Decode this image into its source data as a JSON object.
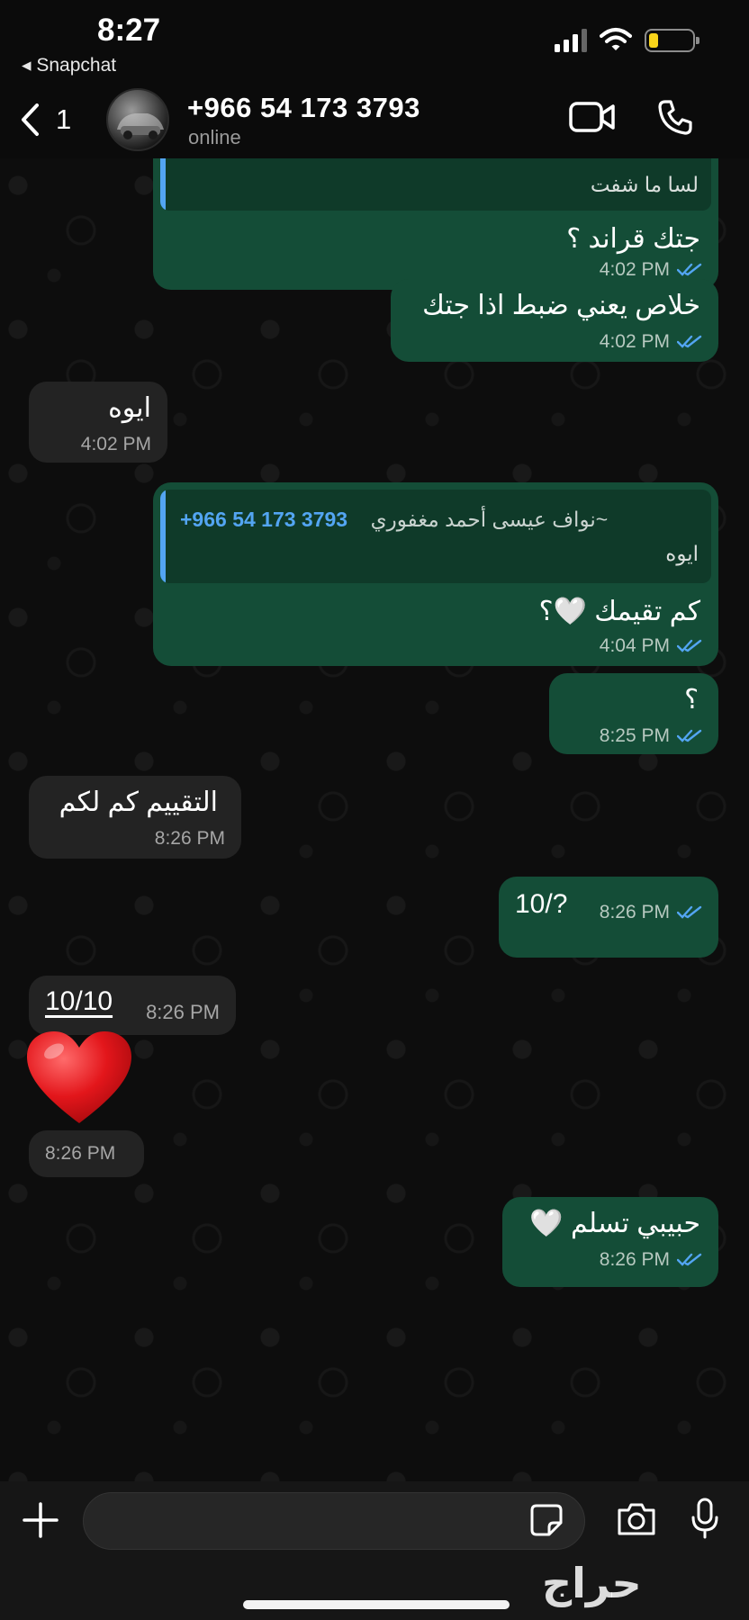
{
  "status_bar": {
    "time": "8:27",
    "back_app": "◂ Snapchat",
    "battery_level": 0.22
  },
  "header": {
    "back_count": "1",
    "contact_name": "+966 54 173 3793",
    "contact_status": "online"
  },
  "messages": [
    {
      "direction": "out",
      "quote_text": "لسا ما شفت",
      "text": "جتك قراند ؟",
      "time": "4:02 PM",
      "read": true
    },
    {
      "direction": "out",
      "text": "خلاص يعني ضبط اذا جتك",
      "time": "4:02 PM",
      "read": true
    },
    {
      "direction": "in",
      "text": "ايوه",
      "time": "4:02 PM"
    },
    {
      "direction": "out",
      "quote_author": "~نواف عيسى أحمد مغفوري",
      "quote_phone": "+966 54 173 3793",
      "quote_text": "ايوه",
      "text": "كم تقيمك 🤍؟",
      "time": "4:04 PM",
      "read": true
    },
    {
      "direction": "out",
      "text": "؟",
      "time": "8:25 PM",
      "read": true
    },
    {
      "direction": "in",
      "text": "التقييم كم لكم",
      "time": "8:26 PM"
    },
    {
      "direction": "out",
      "text": "10/?",
      "time": "8:26 PM",
      "read": true
    },
    {
      "direction": "in",
      "text": "10/10",
      "time": "8:26 PM"
    },
    {
      "direction": "in",
      "emoji": "red-heart",
      "time": "8:26 PM"
    },
    {
      "direction": "out",
      "text": "حبيبي تسلم 🤍",
      "time": "8:26 PM",
      "read": true
    }
  ],
  "composer": {
    "placeholder": "",
    "watermark": "حراج"
  },
  "colors": {
    "outgoing_bubble": "#144d37",
    "incoming_bubble": "#232323",
    "read_tick": "#53a5f2",
    "quote_bar": "#53a5f2",
    "battery": "#f8d41a"
  },
  "icons": [
    "back-chevron-icon",
    "video-call-icon",
    "voice-call-icon",
    "plus-icon",
    "sticker-icon",
    "camera-icon",
    "mic-icon",
    "double-tick-icon"
  ]
}
